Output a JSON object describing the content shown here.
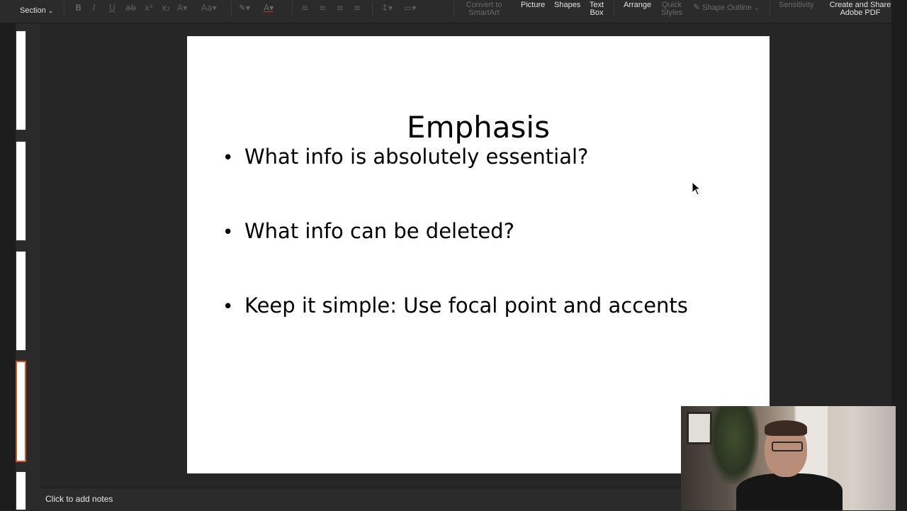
{
  "ribbon": {
    "section_label": "Section",
    "convert_smartart_label_1": "Convert to",
    "convert_smartart_label_2": "SmartArt",
    "picture_label": "Picture",
    "shapes_label": "Shapes",
    "textbox_label_1": "Text",
    "textbox_label_2": "Box",
    "arrange_label": "Arrange",
    "quickstyles_label_1": "Quick",
    "quickstyles_label_2": "Styles",
    "shape_outline_label": "Shape Outline",
    "sensitivity_label": "Sensitivity",
    "adobe_label_1": "Create and Share",
    "adobe_label_2": "Adobe PDF"
  },
  "slide": {
    "title": "Emphasis",
    "bullets": [
      "What info is absolutely essential?",
      "What info can be deleted?",
      "Keep it simple: Use focal point and accents"
    ]
  },
  "notes": {
    "placeholder": "Click to add notes"
  },
  "colors": {
    "selected_thumb_border": "#d1542d",
    "app_background": "#262626"
  }
}
